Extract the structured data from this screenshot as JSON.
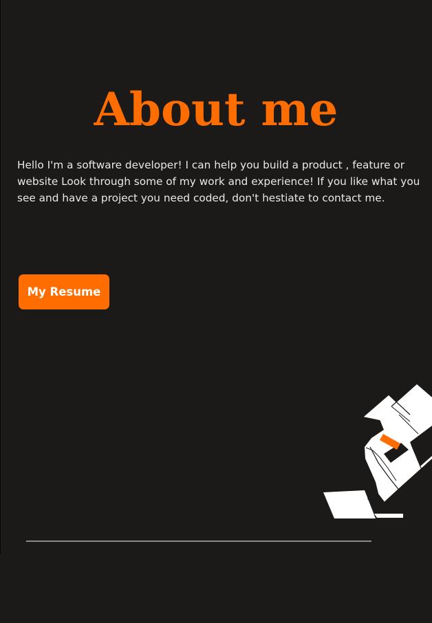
{
  "about": {
    "title": "About me",
    "intro": "Hello I'm a software developer! I can help you build a product , feature or website Look through some of my work and experience! If you like what you see and have a project you need coded, don't hestiate to contact me.",
    "resume_button_label": "My Resume"
  },
  "illustration": {
    "icon": "abstract-ribbon-illustration"
  },
  "colors": {
    "background": "#1b1a19",
    "accent": "#ff6d00",
    "text": "#e9e9e9",
    "divider": "#8c8c8c"
  }
}
